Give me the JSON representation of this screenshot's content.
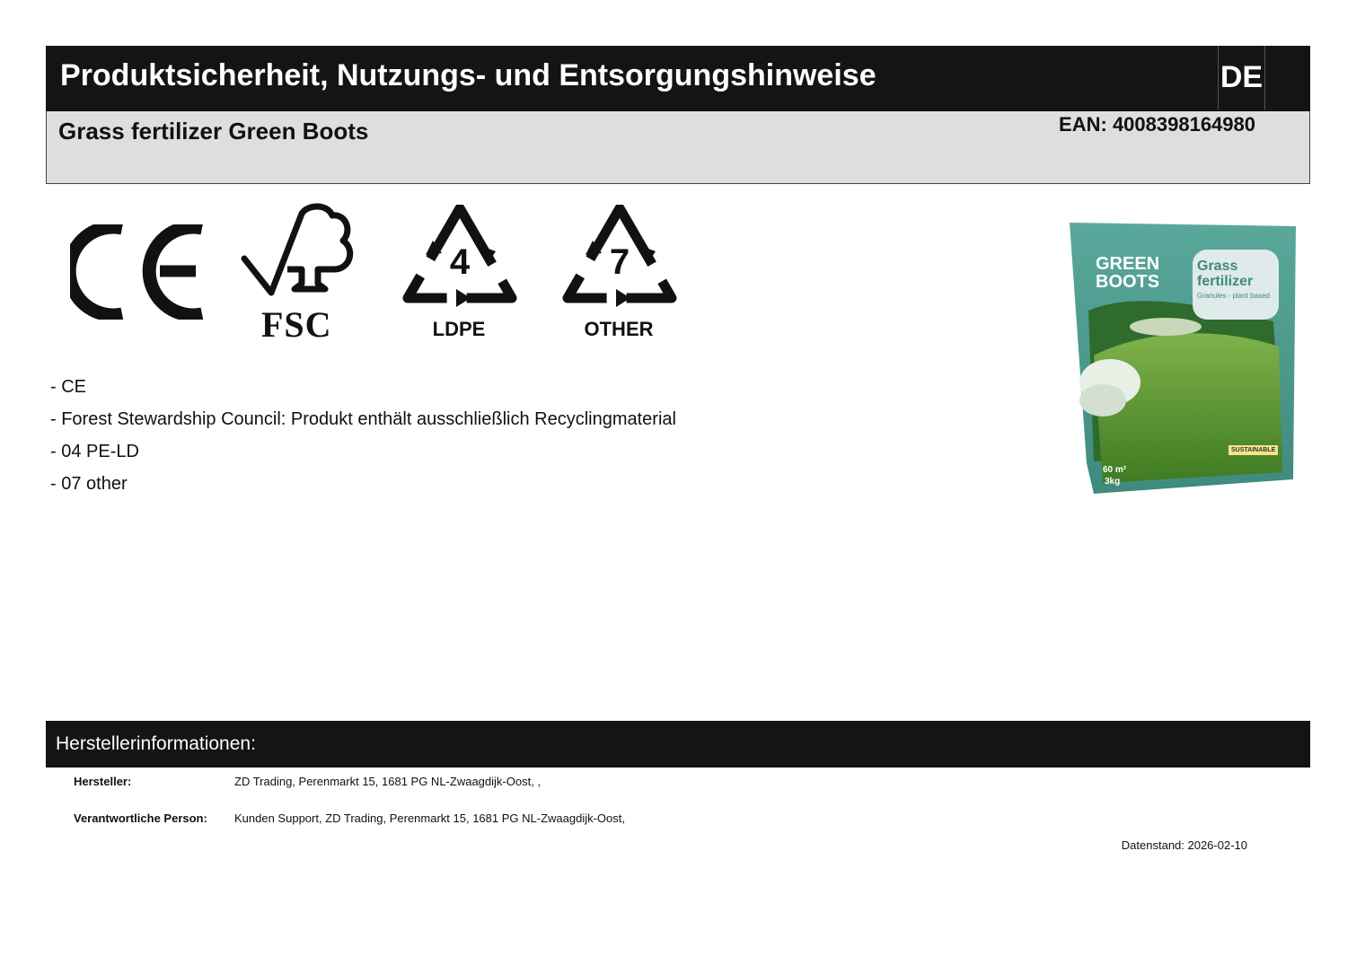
{
  "header": {
    "title": "Produktsicherheit, Nutzungs- und Entsorgungshinweise",
    "language": "DE"
  },
  "product": {
    "name": "Grass fertilizer Green Boots",
    "ean_label": "EAN:",
    "ean": "4008398164980"
  },
  "symbols": {
    "ce": {
      "icon": "ce-mark-icon"
    },
    "fsc": {
      "icon": "fsc-tree-icon",
      "label": "FSC"
    },
    "ldpe": {
      "icon": "recycling-triangle-icon",
      "number": "4",
      "label": "LDPE"
    },
    "other": {
      "icon": "recycling-triangle-icon",
      "number": "7",
      "label": "OTHER"
    }
  },
  "notes": [
    "- CE",
    "- Forest Stewardship Council: Produkt enthält ausschließlich Recyclingmaterial",
    "- 04 PE-LD",
    "- 07 other"
  ],
  "package": {
    "brand_line1": "GREEN",
    "brand_line2": "BOOTS",
    "product_line1": "Grass",
    "product_line2": "fertilizer",
    "tagline": "Granules - plant based",
    "badge": "SUSTAINABLE",
    "area": "60 m²",
    "weight": "3kg"
  },
  "manufacturer": {
    "section_title": "Herstellerinformationen:",
    "manufacturer_label": "Hersteller:",
    "manufacturer_value": "ZD Trading, Perenmarkt 15, 1681 PG  NL-Zwaagdijk-Oost, ,",
    "responsible_label": "Verantwortliche Person:",
    "responsible_value": "Kunden Support, ZD Trading, Perenmarkt 15, 1681 PG  NL-Zwaagdijk-Oost,"
  },
  "footer": {
    "date": "Datenstand: 2026-02-10"
  },
  "colors": {
    "header_bg": "#141414",
    "subheader_bg": "#dedede",
    "package_teal": "#4f9a8e",
    "grass": "#5c9a32"
  }
}
